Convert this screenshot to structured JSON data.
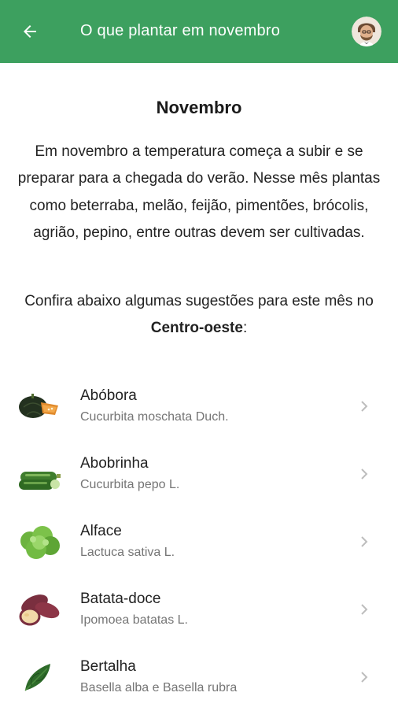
{
  "appbar": {
    "title": "O que plantar em novembro",
    "back_icon": "arrow-left-icon",
    "avatar_icon": "user-avatar",
    "color": "#3da05f"
  },
  "content": {
    "heading": "Novembro",
    "intro": "Em novembro a temperatura começa a subir e se preparar para a chegada do verão. Nesse mês plantas como beterraba, melão, feijão, pimentões, brócolis, agrião, pepino, entre outras devem ser cultivadas.",
    "suggest_prefix": "Confira abaixo algumas sugestões para este mês no ",
    "region": "Centro-oeste",
    "suggest_suffix": ":"
  },
  "plants": [
    {
      "name": "Abóbora",
      "scientific": "Cucurbita moschata Duch.",
      "icon": "pumpkin-icon"
    },
    {
      "name": "Abobrinha",
      "scientific": "Cucurbita pepo L.",
      "icon": "zucchini-icon"
    },
    {
      "name": "Alface",
      "scientific": "Lactuca sativa L.",
      "icon": "lettuce-icon"
    },
    {
      "name": "Batata-doce",
      "scientific": "Ipomoea batatas L.",
      "icon": "sweet-potato-icon"
    },
    {
      "name": "Bertalha",
      "scientific": "Basella alba e Basella rubra",
      "icon": "bertalha-leaf-icon"
    }
  ]
}
